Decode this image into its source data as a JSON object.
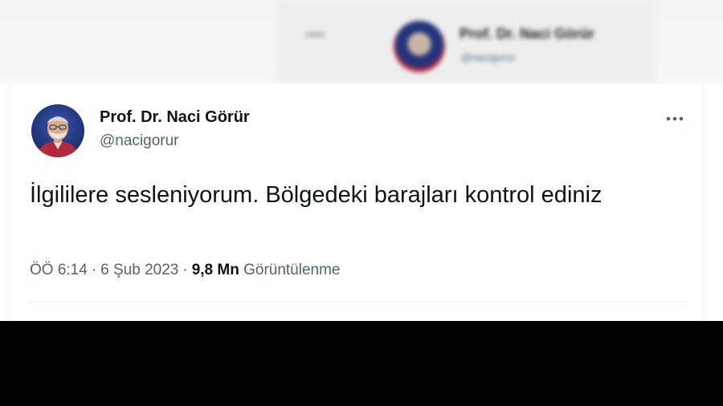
{
  "header_blurred": {
    "name": "Prof. Dr. Naci Görür",
    "handle": "@nacigorur"
  },
  "tweet": {
    "author": {
      "display_name": "Prof. Dr. Naci Görür",
      "handle": "@nacigorur"
    },
    "text": "İlgililere sesleniyorum. Bölgedeki barajları kontrol ediniz",
    "time": "ÖÖ 6:14",
    "date": "6 Şub 2023",
    "views_count": "9,8 Mn",
    "views_label": "Görüntülenme",
    "separator": "·"
  },
  "icons": {
    "more": "more-horizontal-icon",
    "back": "back-arrow-icon"
  },
  "colors": {
    "primary_text": "#0f1419",
    "secondary_text": "#536471",
    "divider": "#eff3f4",
    "band": "#000000"
  }
}
